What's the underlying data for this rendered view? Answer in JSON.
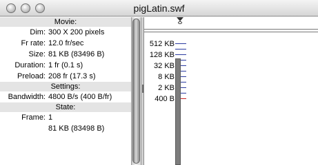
{
  "window": {
    "title": "pigLatin.swf"
  },
  "sections": {
    "movie": "Movie:",
    "settings": "Settings:",
    "state": "State:"
  },
  "movie": {
    "dim_label": "Dim:",
    "dim_value": "300 X 200 pixels",
    "fr_label": "Fr rate:",
    "fr_value": "12.0 fr/sec",
    "size_label": "Size:",
    "size_value": "81 KB (83496 B)",
    "duration_label": "Duration:",
    "duration_value": "1 fr (0.1 s)",
    "preload_label": "Preload:",
    "preload_value": "208 fr (17.3 s)"
  },
  "settings": {
    "bandwidth_label": "Bandwidth:",
    "bandwidth_value": "4800 B/s (400 B/fr)"
  },
  "state": {
    "frame_label": "Frame:",
    "frame_value": "1",
    "size_value": "81 KB (83498 B)"
  },
  "graph": {
    "labels": [
      "512 KB",
      "128 KB",
      "32 KB",
      "8 KB",
      "2 KB",
      "400 B"
    ],
    "colors": {
      "tick": "#2a3aa0",
      "limit": "#c81e1e",
      "bar": "#7d7d7d"
    }
  }
}
